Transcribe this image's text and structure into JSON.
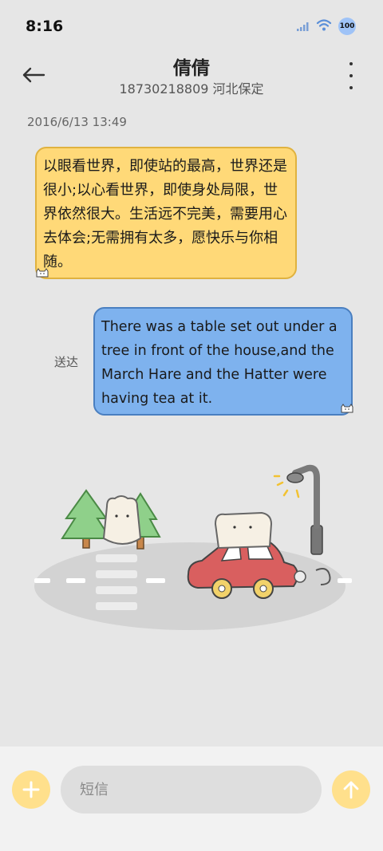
{
  "status_bar": {
    "time": "8:16",
    "battery_level": "100"
  },
  "header": {
    "contact_name": "倩倩",
    "contact_subtitle": "18730218809 河北保定"
  },
  "conversation": {
    "timestamp": "2016/6/13 13:49",
    "messages": [
      {
        "direction": "incoming",
        "text": "以眼看世界，即使站的最高，世界还是很小;以心看世界，即使身处局限，世界依然很大。生活远不完美，需要用心去体会;无需拥有太多，愿快乐与你相随。"
      },
      {
        "direction": "outgoing",
        "text": "There was a table set out under a tree in front of the house,and the March Hare and the Hatter were having tea at it.",
        "status": "送达"
      }
    ]
  },
  "composer": {
    "placeholder": "短信"
  },
  "colors": {
    "incoming_bubble": "#ffd978",
    "outgoing_bubble": "#7eb2ee",
    "accent": "#ffe08c"
  }
}
